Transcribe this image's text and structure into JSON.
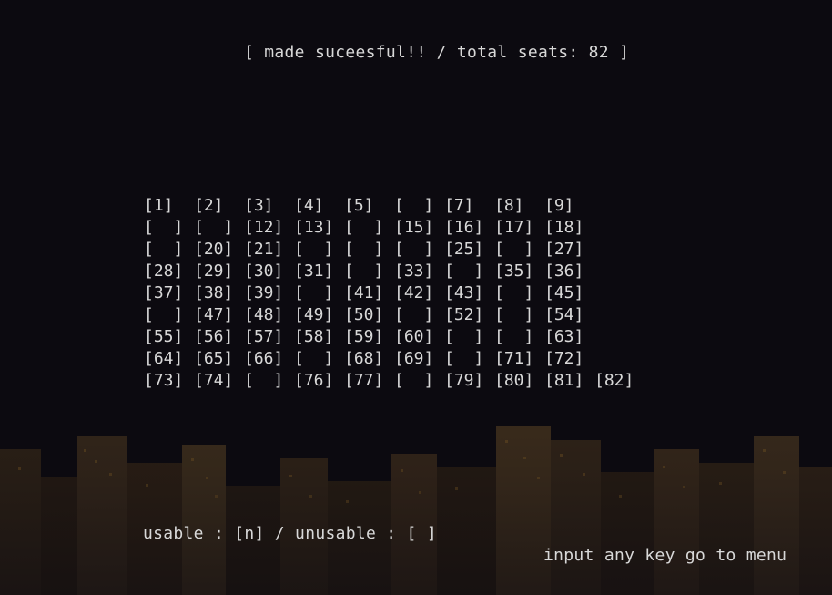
{
  "status": {
    "message": "[ made suceesful!! / total seats: 82 ]"
  },
  "seats": {
    "rows": [
      [
        "[1]",
        "[2]",
        "[3]",
        "[4]",
        "[5]",
        "[  ]",
        "[7]",
        "[8]",
        "[9]"
      ],
      [
        "[  ]",
        "[  ]",
        "[12]",
        "[13]",
        "[  ]",
        "[15]",
        "[16]",
        "[17]",
        "[18]"
      ],
      [
        "[  ]",
        "[20]",
        "[21]",
        "[  ]",
        "[  ]",
        "[  ]",
        "[25]",
        "[  ]",
        "[27]"
      ],
      [
        "[28]",
        "[29]",
        "[30]",
        "[31]",
        "[  ]",
        "[33]",
        "[  ]",
        "[35]",
        "[36]"
      ],
      [
        "[37]",
        "[38]",
        "[39]",
        "[  ]",
        "[41]",
        "[42]",
        "[43]",
        "[  ]",
        "[45]"
      ],
      [
        "[  ]",
        "[47]",
        "[48]",
        "[49]",
        "[50]",
        "[  ]",
        "[52]",
        "[  ]",
        "[54]"
      ],
      [
        "[55]",
        "[56]",
        "[57]",
        "[58]",
        "[59]",
        "[60]",
        "[  ]",
        "[  ]",
        "[63]"
      ],
      [
        "[64]",
        "[65]",
        "[66]",
        "[  ]",
        "[68]",
        "[69]",
        "[  ]",
        "[71]",
        "[72]"
      ],
      [
        "[73]",
        "[74]",
        "[  ]",
        "[76]",
        "[77]",
        "[  ]",
        "[79]",
        "[80]",
        "[81]",
        "[82]"
      ]
    ]
  },
  "legend": {
    "text": "usable : [n] / unusable : [ ]"
  },
  "prompt": {
    "text": "input any key go to menu"
  },
  "colors": {
    "background": "#0c0a10",
    "text": "#d8d8d8"
  }
}
